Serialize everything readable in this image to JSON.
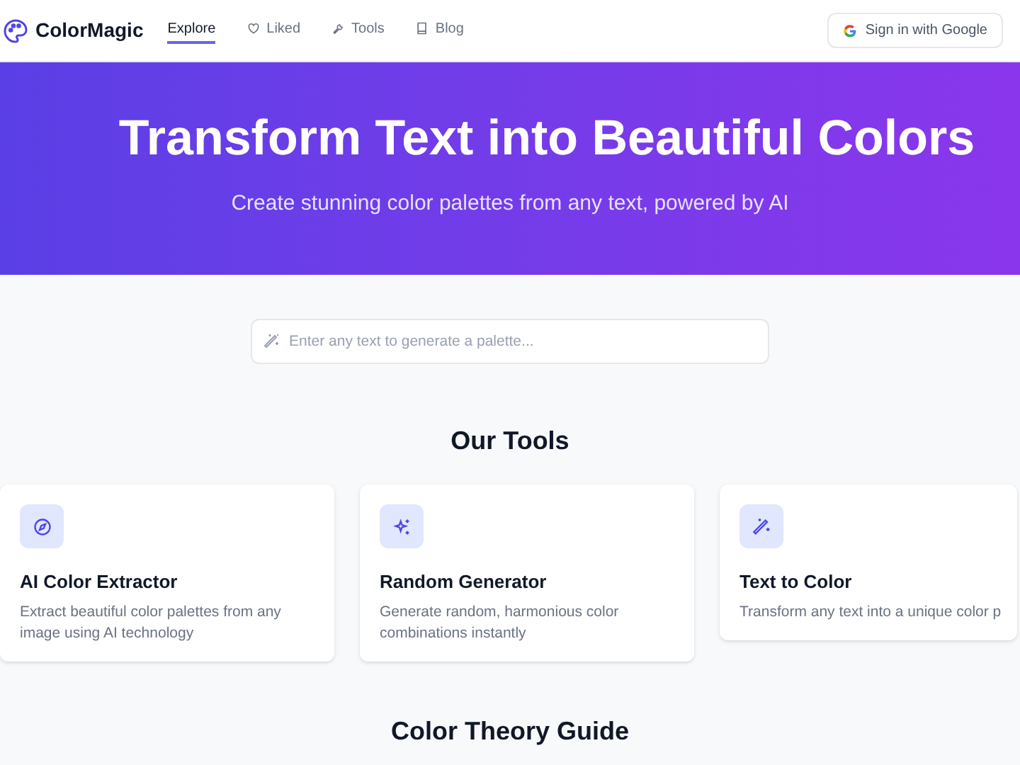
{
  "brand": "ColorMagic",
  "nav": [
    {
      "label": "Explore",
      "selected": true
    },
    {
      "label": "Liked",
      "selected": false
    },
    {
      "label": "Tools",
      "selected": false
    },
    {
      "label": "Blog",
      "selected": false
    }
  ],
  "sign_in": "Sign in with Google",
  "hero": {
    "title": "Transform Text into Beautiful Colors",
    "subtitle": "Create stunning color palettes from any text, powered by AI"
  },
  "search": {
    "placeholder": "Enter any text to generate a palette..."
  },
  "tools_heading": "Our Tools",
  "tools": [
    {
      "title": "AI Color Extractor",
      "description": "Extract beautiful color palettes from any image using AI technology"
    },
    {
      "title": "Random Generator",
      "description": "Generate random, harmonious color combinations instantly"
    },
    {
      "title": "Text to Color",
      "description": "Transform any text into a unique color p"
    }
  ],
  "guide_heading": "Color Theory Guide"
}
